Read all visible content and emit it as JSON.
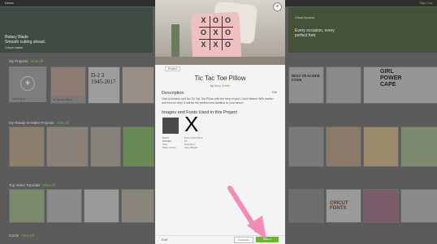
{
  "topbar": {
    "home": "Home",
    "right_link": "Sign Out"
  },
  "banners": [
    {
      "text": "Rotary Blade\nSmooth cutting ahead.",
      "brand": "Cricut maker"
    },
    {
      "text": "",
      "brand": ""
    },
    {
      "text": "Every occasion, every\nperfect font.",
      "brand": "Cricut Access"
    }
  ],
  "sections": {
    "my_projects": {
      "label": "My Projects",
      "link": "View All"
    },
    "ready_to_make": {
      "label": "My Ready-to-Make Projects",
      "link": "View All"
    },
    "videos": {
      "label": "Top Video Tutorials",
      "link": "View All"
    },
    "cards": {
      "label": "Cards",
      "link": "View All"
    }
  },
  "new_project": {
    "label": "New Project"
  },
  "project_cards": [
    "Tic Tac Toe Pillow",
    "",
    "",
    "",
    "",
    "",
    ""
  ],
  "modal": {
    "cut_badge": "Project",
    "title": "Tic Tac Toe Pillow",
    "by": "by",
    "author": "Amy Smith",
    "description_heading": "Description",
    "likes": "Edit",
    "description": "Give a modern and fun Tic Tac Toe Pillow with the help of your Cricut Maker! With leather and iron-on vinyl, it will be the perfect new addition to your decor!",
    "images_heading": "Images and Fonts Used in this Project",
    "meta1": "Board\n#M4482\nPlus\nMake it Now",
    "meta2": "Font Cricut Sans\n#T\nUnlimited\nFont Weight",
    "edit_link": "Edit",
    "btn_customize": "Customize",
    "btn_make": "Make It",
    "close": "×"
  },
  "accent_colors": {
    "green": "#6ab62e",
    "arrow_pink": "#f38bb7"
  }
}
